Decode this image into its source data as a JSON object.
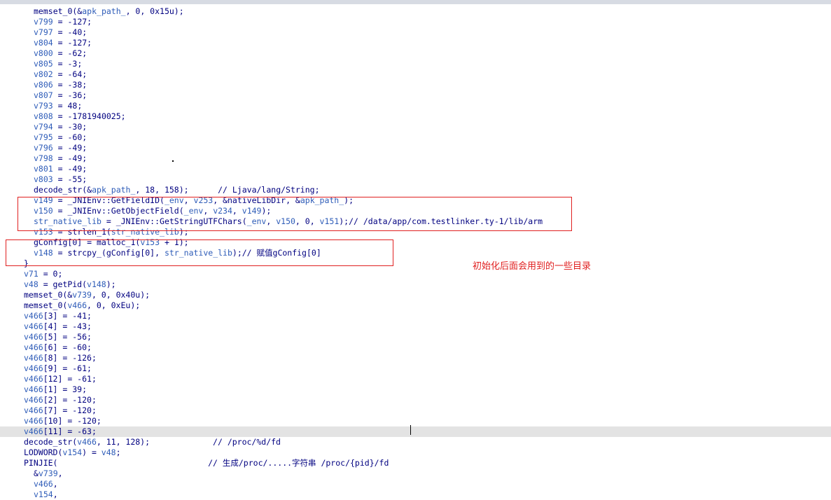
{
  "code_lines": [
    {
      "indent": "  ",
      "parts": [
        {
          "t": "memset_0(&"
        },
        {
          "t": "apk_path_",
          "c": "v"
        },
        {
          "t": ", 0, 0x15u);"
        }
      ]
    },
    {
      "indent": "  ",
      "parts": [
        {
          "t": "v799",
          "c": "v"
        },
        {
          "t": " = -127;"
        }
      ]
    },
    {
      "indent": "  ",
      "parts": [
        {
          "t": "v797",
          "c": "v"
        },
        {
          "t": " = -40;"
        }
      ]
    },
    {
      "indent": "  ",
      "parts": [
        {
          "t": "v804",
          "c": "v"
        },
        {
          "t": " = -127;"
        }
      ]
    },
    {
      "indent": "  ",
      "parts": [
        {
          "t": "v800",
          "c": "v"
        },
        {
          "t": " = -62;"
        }
      ]
    },
    {
      "indent": "  ",
      "parts": [
        {
          "t": "v805",
          "c": "v"
        },
        {
          "t": " = -3;"
        }
      ]
    },
    {
      "indent": "  ",
      "parts": [
        {
          "t": "v802",
          "c": "v"
        },
        {
          "t": " = -64;"
        }
      ]
    },
    {
      "indent": "  ",
      "parts": [
        {
          "t": "v806",
          "c": "v"
        },
        {
          "t": " = -38;"
        }
      ]
    },
    {
      "indent": "  ",
      "parts": [
        {
          "t": "v807",
          "c": "v"
        },
        {
          "t": " = -36;"
        }
      ]
    },
    {
      "indent": "  ",
      "parts": [
        {
          "t": "v793",
          "c": "v"
        },
        {
          "t": " = 48;"
        }
      ]
    },
    {
      "indent": "  ",
      "parts": [
        {
          "t": "v808",
          "c": "v"
        },
        {
          "t": " = -1781940025;"
        }
      ]
    },
    {
      "indent": "  ",
      "parts": [
        {
          "t": "v794",
          "c": "v"
        },
        {
          "t": " = -30;"
        }
      ]
    },
    {
      "indent": "  ",
      "parts": [
        {
          "t": "v795",
          "c": "v"
        },
        {
          "t": " = -60;"
        }
      ]
    },
    {
      "indent": "  ",
      "parts": [
        {
          "t": "v796",
          "c": "v"
        },
        {
          "t": " = -49;"
        }
      ]
    },
    {
      "indent": "  ",
      "parts": [
        {
          "t": "v798",
          "c": "v"
        },
        {
          "t": " = -49;"
        }
      ]
    },
    {
      "indent": "  ",
      "parts": [
        {
          "t": "v801",
          "c": "v"
        },
        {
          "t": " = -49;"
        }
      ]
    },
    {
      "indent": "  ",
      "parts": [
        {
          "t": "v803",
          "c": "v"
        },
        {
          "t": " = -55;"
        }
      ]
    },
    {
      "indent": "  ",
      "parts": [
        {
          "t": "decode_str(&"
        },
        {
          "t": "apk_path_",
          "c": "v"
        },
        {
          "t": ", 18, 158);      "
        },
        {
          "t": "// Ljava/lang/String;",
          "c": "c"
        }
      ]
    },
    {
      "indent": "  ",
      "parts": [
        {
          "t": "v149",
          "c": "v"
        },
        {
          "t": " = _JNIEnv::GetFieldID("
        },
        {
          "t": "_env",
          "c": "v"
        },
        {
          "t": ", "
        },
        {
          "t": "v253",
          "c": "v"
        },
        {
          "t": ", &nativeLibDir, &"
        },
        {
          "t": "apk_path_",
          "c": "v"
        },
        {
          "t": ");"
        }
      ]
    },
    {
      "indent": "  ",
      "parts": [
        {
          "t": "v150",
          "c": "v"
        },
        {
          "t": " = _JNIEnv::GetObjectField("
        },
        {
          "t": "_env",
          "c": "v"
        },
        {
          "t": ", "
        },
        {
          "t": "v234",
          "c": "v"
        },
        {
          "t": ", "
        },
        {
          "t": "v149",
          "c": "v"
        },
        {
          "t": ");"
        }
      ]
    },
    {
      "indent": "  ",
      "parts": [
        {
          "t": "str_native_lib",
          "c": "v"
        },
        {
          "t": " = _JNIEnv::GetStringUTFChars("
        },
        {
          "t": "_env",
          "c": "v"
        },
        {
          "t": ", "
        },
        {
          "t": "v150",
          "c": "v"
        },
        {
          "t": ", 0, "
        },
        {
          "t": "v151",
          "c": "v"
        },
        {
          "t": ");"
        },
        {
          "t": "// /data/app/com.testlinker.ty-1/lib/arm",
          "c": "c"
        }
      ]
    },
    {
      "indent": "  ",
      "parts": [
        {
          "t": "v153",
          "c": "v"
        },
        {
          "t": " = strlen_1("
        },
        {
          "t": "str_native_lib",
          "c": "v"
        },
        {
          "t": ");"
        }
      ]
    },
    {
      "indent": "  ",
      "parts": [
        {
          "t": "gConfig[0] = malloc_1("
        },
        {
          "t": "v153",
          "c": "v"
        },
        {
          "t": " + 1);"
        }
      ]
    },
    {
      "indent": "  ",
      "parts": [
        {
          "t": "v148",
          "c": "v"
        },
        {
          "t": " = strcpy_(gConfig[0], "
        },
        {
          "t": "str_native_lib",
          "c": "v"
        },
        {
          "t": ");"
        },
        {
          "t": "// 赋值gConfig[0]",
          "c": "c"
        }
      ]
    },
    {
      "indent": "",
      "parts": [
        {
          "t": "}"
        }
      ]
    },
    {
      "indent": "",
      "parts": [
        {
          "t": "v71",
          "c": "v"
        },
        {
          "t": " = 0;"
        }
      ]
    },
    {
      "indent": "",
      "parts": [
        {
          "t": "v48",
          "c": "v"
        },
        {
          "t": " = getPid("
        },
        {
          "t": "v148",
          "c": "v"
        },
        {
          "t": ");"
        }
      ]
    },
    {
      "indent": "",
      "parts": [
        {
          "t": "memset_0(&"
        },
        {
          "t": "v739",
          "c": "v"
        },
        {
          "t": ", 0, 0x40u);"
        }
      ]
    },
    {
      "indent": "",
      "parts": [
        {
          "t": "memset_0("
        },
        {
          "t": "v466",
          "c": "v"
        },
        {
          "t": ", 0, 0xEu);"
        }
      ]
    },
    {
      "indent": "",
      "parts": [
        {
          "t": "v466",
          "c": "v"
        },
        {
          "t": "[3] = -41;"
        }
      ]
    },
    {
      "indent": "",
      "parts": [
        {
          "t": "v466",
          "c": "v"
        },
        {
          "t": "[4] = -43;"
        }
      ]
    },
    {
      "indent": "",
      "parts": [
        {
          "t": "v466",
          "c": "v"
        },
        {
          "t": "[5] = -56;"
        }
      ]
    },
    {
      "indent": "",
      "parts": [
        {
          "t": "v466",
          "c": "v"
        },
        {
          "t": "[6] = -60;"
        }
      ]
    },
    {
      "indent": "",
      "parts": [
        {
          "t": "v466",
          "c": "v"
        },
        {
          "t": "[8] = -126;"
        }
      ]
    },
    {
      "indent": "",
      "parts": [
        {
          "t": "v466",
          "c": "v"
        },
        {
          "t": "[9] = -61;"
        }
      ]
    },
    {
      "indent": "",
      "parts": [
        {
          "t": "v466",
          "c": "v"
        },
        {
          "t": "[12] = -61;"
        }
      ]
    },
    {
      "indent": "",
      "parts": [
        {
          "t": "v466",
          "c": "v"
        },
        {
          "t": "[1] = 39;"
        }
      ]
    },
    {
      "indent": "",
      "parts": [
        {
          "t": "v466",
          "c": "v"
        },
        {
          "t": "[2] = -120;"
        }
      ]
    },
    {
      "indent": "",
      "parts": [
        {
          "t": "v466",
          "c": "v"
        },
        {
          "t": "[7] = -120;"
        }
      ]
    },
    {
      "indent": "",
      "parts": [
        {
          "t": "v466",
          "c": "v"
        },
        {
          "t": "[10] = -120;"
        }
      ]
    },
    {
      "indent": "",
      "parts": [
        {
          "t": "v466",
          "c": "v"
        },
        {
          "t": "[11] = -63;"
        }
      ],
      "highlight": true
    },
    {
      "indent": "",
      "parts": [
        {
          "t": "decode_str("
        },
        {
          "t": "v466",
          "c": "v"
        },
        {
          "t": ", 11, 128);             "
        },
        {
          "t": "// /proc/%d/fd",
          "c": "c"
        }
      ]
    },
    {
      "indent": "",
      "parts": [
        {
          "t": "LODWORD("
        },
        {
          "t": "v154",
          "c": "v"
        },
        {
          "t": ") = "
        },
        {
          "t": "v48",
          "c": "v"
        },
        {
          "t": ";"
        }
      ]
    },
    {
      "indent": "",
      "parts": [
        {
          "t": "PINJIE(                               "
        },
        {
          "t": "// 生成/proc/.....字符串 /proc/{pid}/fd",
          "c": "c"
        }
      ]
    },
    {
      "indent": "  ",
      "parts": [
        {
          "t": "&"
        },
        {
          "t": "v739",
          "c": "v"
        },
        {
          "t": ","
        }
      ]
    },
    {
      "indent": "  ",
      "parts": [
        {
          "t": "v466",
          "c": "v"
        },
        {
          "t": ","
        }
      ]
    },
    {
      "indent": "  ",
      "parts": [
        {
          "t": "v154",
          "c": "v"
        },
        {
          "t": ","
        }
      ]
    }
  ],
  "annotation": "初始化后面会用到的一些目录",
  "colors": {
    "code": "#000080",
    "variable": "#2e5cb8",
    "annotation": "#e02020",
    "highlight": "#e3e3e3"
  }
}
